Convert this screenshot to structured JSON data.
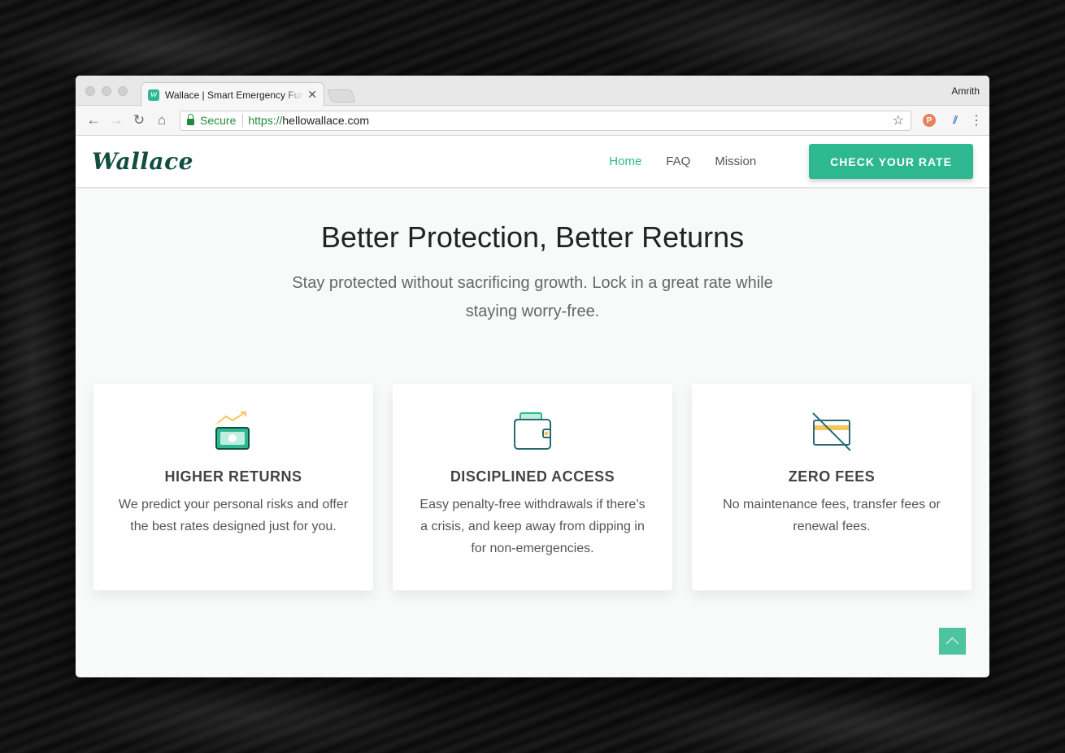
{
  "browser": {
    "tab_title": "Wallace | Smart Emergency Fund",
    "favicon_letter": "w",
    "profile_name": "Amrith",
    "secure_label": "Secure",
    "url_scheme": "https://",
    "url_host": "hellowallace.com",
    "extension_p": "P"
  },
  "site": {
    "logo": "Wallace",
    "nav": [
      {
        "label": "Home",
        "active": true
      },
      {
        "label": "FAQ",
        "active": false
      },
      {
        "label": "Mission",
        "active": false
      }
    ],
    "cta_label": "CHECK YOUR RATE"
  },
  "hero": {
    "title": "Better Protection, Better Returns",
    "subtitle": "Stay protected without sacrificing growth. Lock in a great rate while staying worry-free."
  },
  "features": [
    {
      "icon": "money-growth-icon",
      "title": "HIGHER RETURNS",
      "text": "We predict your personal risks and offer the best rates designed just for you."
    },
    {
      "icon": "wallet-icon",
      "title": "DISCIPLINED ACCESS",
      "text": "Easy penalty-free withdrawals if there’s a crisis, and keep away from dipping in for non-emergencies."
    },
    {
      "icon": "no-card-icon",
      "title": "ZERO FEES",
      "text": "No maintenance fees, transfer fees or renewal fees."
    }
  ],
  "colors": {
    "brand": "#2db892",
    "brand_dark": "#104e3f",
    "accent_yellow": "#f6c75a"
  }
}
